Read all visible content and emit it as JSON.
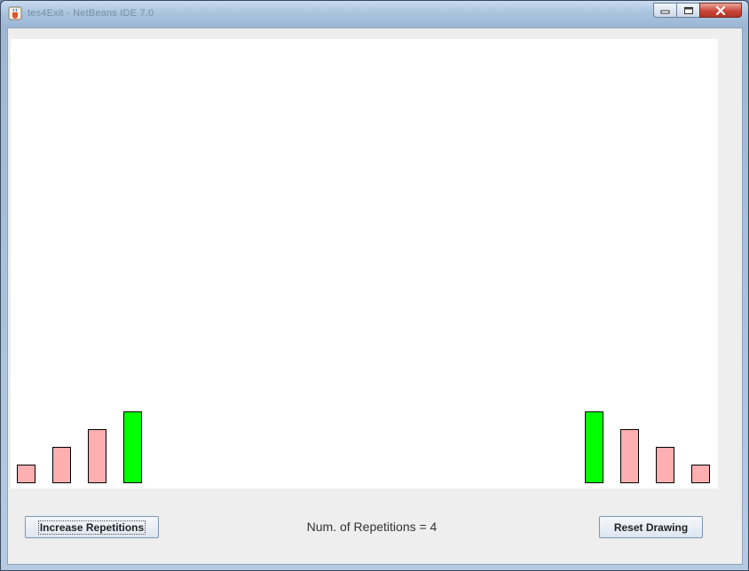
{
  "window": {
    "title": "tes4Exit - NetBeans IDE 7.0"
  },
  "title_icon": "java-cup-icon",
  "controls": [
    "minimize-icon",
    "maximize-icon",
    "close-icon"
  ],
  "canvas": {
    "background": "#ffffff",
    "bar_colors": {
      "normal": "#ffafaf",
      "highlight": "#00ff00",
      "outline": "#000000"
    },
    "left_bars": [
      {
        "level": 1,
        "highlight": false
      },
      {
        "level": 2,
        "highlight": false
      },
      {
        "level": 3,
        "highlight": false
      },
      {
        "level": 4,
        "highlight": true
      }
    ],
    "right_bars": [
      {
        "level": 4,
        "highlight": true
      },
      {
        "level": 3,
        "highlight": false
      },
      {
        "level": 2,
        "highlight": false
      },
      {
        "level": 1,
        "highlight": false
      }
    ]
  },
  "controls_panel": {
    "increase_label": "Increase Repetitions",
    "status_text": "Num. of Repetitions = 4",
    "reset_label": "Reset Drawing"
  }
}
